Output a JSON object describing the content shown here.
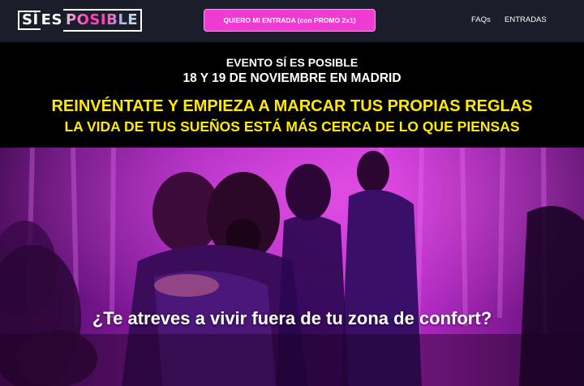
{
  "header": {
    "logo": {
      "part1": "SÍ",
      "part2": "ES",
      "part3": "POSIBLE"
    },
    "cta_button": "QUIERO MI ENTRADA (con PROMO 2x1)",
    "nav": [
      {
        "label": "FAQs"
      },
      {
        "label": "ENTRADAS"
      }
    ]
  },
  "hero": {
    "event_label": "EVENTO SÍ ES POSIBLE",
    "event_date": "18 Y 19 DE NOVIEMBRE EN MADRID",
    "headline": "REINVÉNTATE Y EMPIEZA A MARCAR TUS PROPIAS REGLAS",
    "subheadline": "LA VIDA DE TUS SUEÑOS ESTÁ MÁS CERCA DE LO QUE PIENSAS"
  },
  "photo_section": {
    "question": "¿Te atreves a vivir fuera de tu zona de confort?"
  },
  "colors": {
    "nav_bg": "#1b1d2b",
    "cta_bg": "#f03bd3",
    "headline": "#ffea00",
    "photo_tint": "#b01fd0"
  }
}
